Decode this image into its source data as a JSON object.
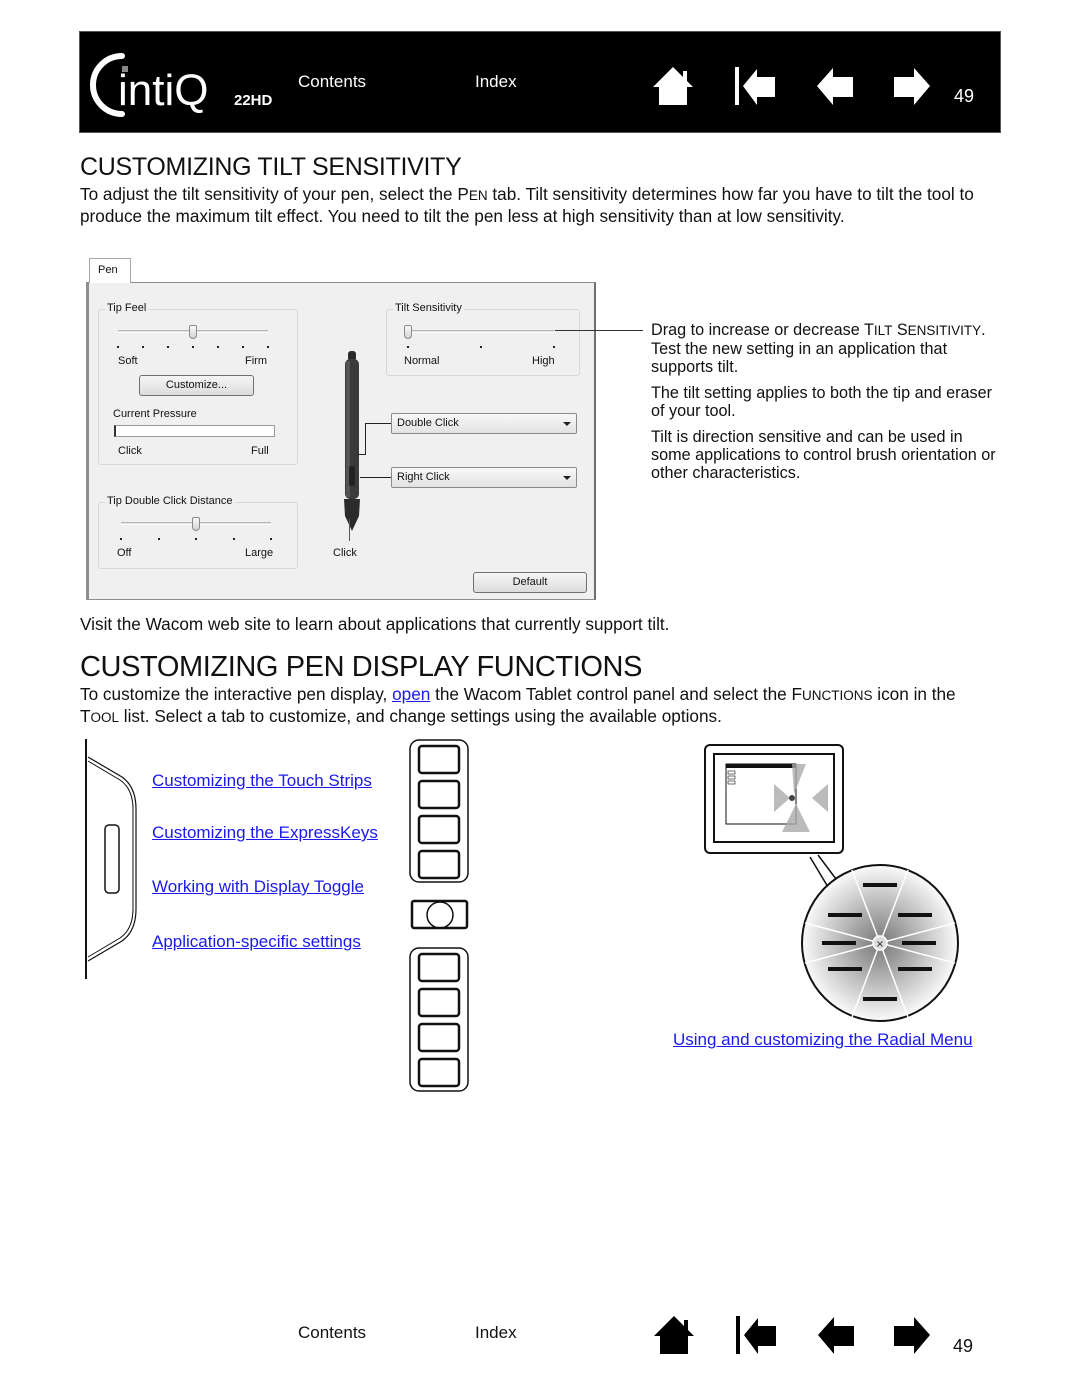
{
  "header": {
    "logo_text": "intiQ",
    "logo_model": "22HD",
    "contents_label": "Contents",
    "index_label": "Index",
    "nav_icons": [
      "home-icon",
      "first-page-icon",
      "previous-page-icon",
      "next-page-icon"
    ],
    "page_number": "49"
  },
  "tilt_section": {
    "heading": "CUSTOMIZING TILT SENSITIVITY",
    "intro_part1": "To adjust the tilt sensitivity of your pen, select the P",
    "intro_pen_sc": "EN",
    "intro_part2": " tab.  Tilt sensitivity determines how far you have to tilt the tool to produce the maximum tilt effect.  You need to tilt the pen less at high sensitivity than at low sensitivity.",
    "dialog": {
      "tab_label": "Pen",
      "tip_feel": {
        "title": "Tip Feel",
        "min_label": "Soft",
        "max_label": "Firm",
        "value_fraction": 0.5,
        "ticks": 7,
        "customize_button": "Customize...",
        "pressure_label": "Current Pressure",
        "pressure_min": "Click",
        "pressure_max": "Full"
      },
      "tilt_sensitivity": {
        "title": "Tilt Sensitivity",
        "min_label": "Normal",
        "max_label": "High",
        "value_fraction": 0.0,
        "ticks": 3
      },
      "side_switch_upper": "Double Click",
      "side_switch_lower": "Right Click",
      "tip_label": "Click",
      "double_click_distance": {
        "title": "Tip Double Click Distance",
        "min_label": "Off",
        "max_label": "Large",
        "value_fraction": 0.5,
        "ticks": 5
      },
      "default_button": "Default"
    },
    "callout": {
      "p1_part1": "Drag to increase or decrease T",
      "p1_sc1": "ILT",
      "p1_part2": " S",
      "p1_sc2": "ENSITIVITY",
      "p1_part3": ".  Test the new setting in an application that supports tilt.",
      "p2": "The tilt setting applies to both the tip and eraser of your tool.",
      "p3": "Tilt is direction sensitive and can be used in some applications to control brush orientation or other characteristics."
    },
    "visit_text": "Visit the Wacom web site to learn about applications that currently support tilt."
  },
  "functions_section": {
    "heading": "CUSTOMIZING PEN DISPLAY FUNCTIONS",
    "intro_part1": "To customize the interactive pen display, ",
    "intro_link": "open",
    "intro_part2": " the Wacom Tablet control panel and select the F",
    "intro_sc1": "UNCTIONS",
    "intro_part3": " icon in the T",
    "intro_sc2": "OOL",
    "intro_part4": " list.  Select a tab to customize, and change settings using the available options.",
    "links": [
      "Customizing the Touch Strips",
      "Customizing the ExpressKeys",
      "Working with Display Toggle",
      "Application-specific settings"
    ],
    "radial_link": "Using and customizing the Radial Menu"
  },
  "footer": {
    "contents_label": "Contents",
    "index_label": "Index",
    "nav_icons": [
      "home-icon",
      "first-page-icon",
      "previous-page-icon",
      "next-page-icon"
    ],
    "page_number": "49"
  },
  "colors": {
    "link": "#1a1aee",
    "header_bg": "#000000",
    "text": "#111111"
  }
}
